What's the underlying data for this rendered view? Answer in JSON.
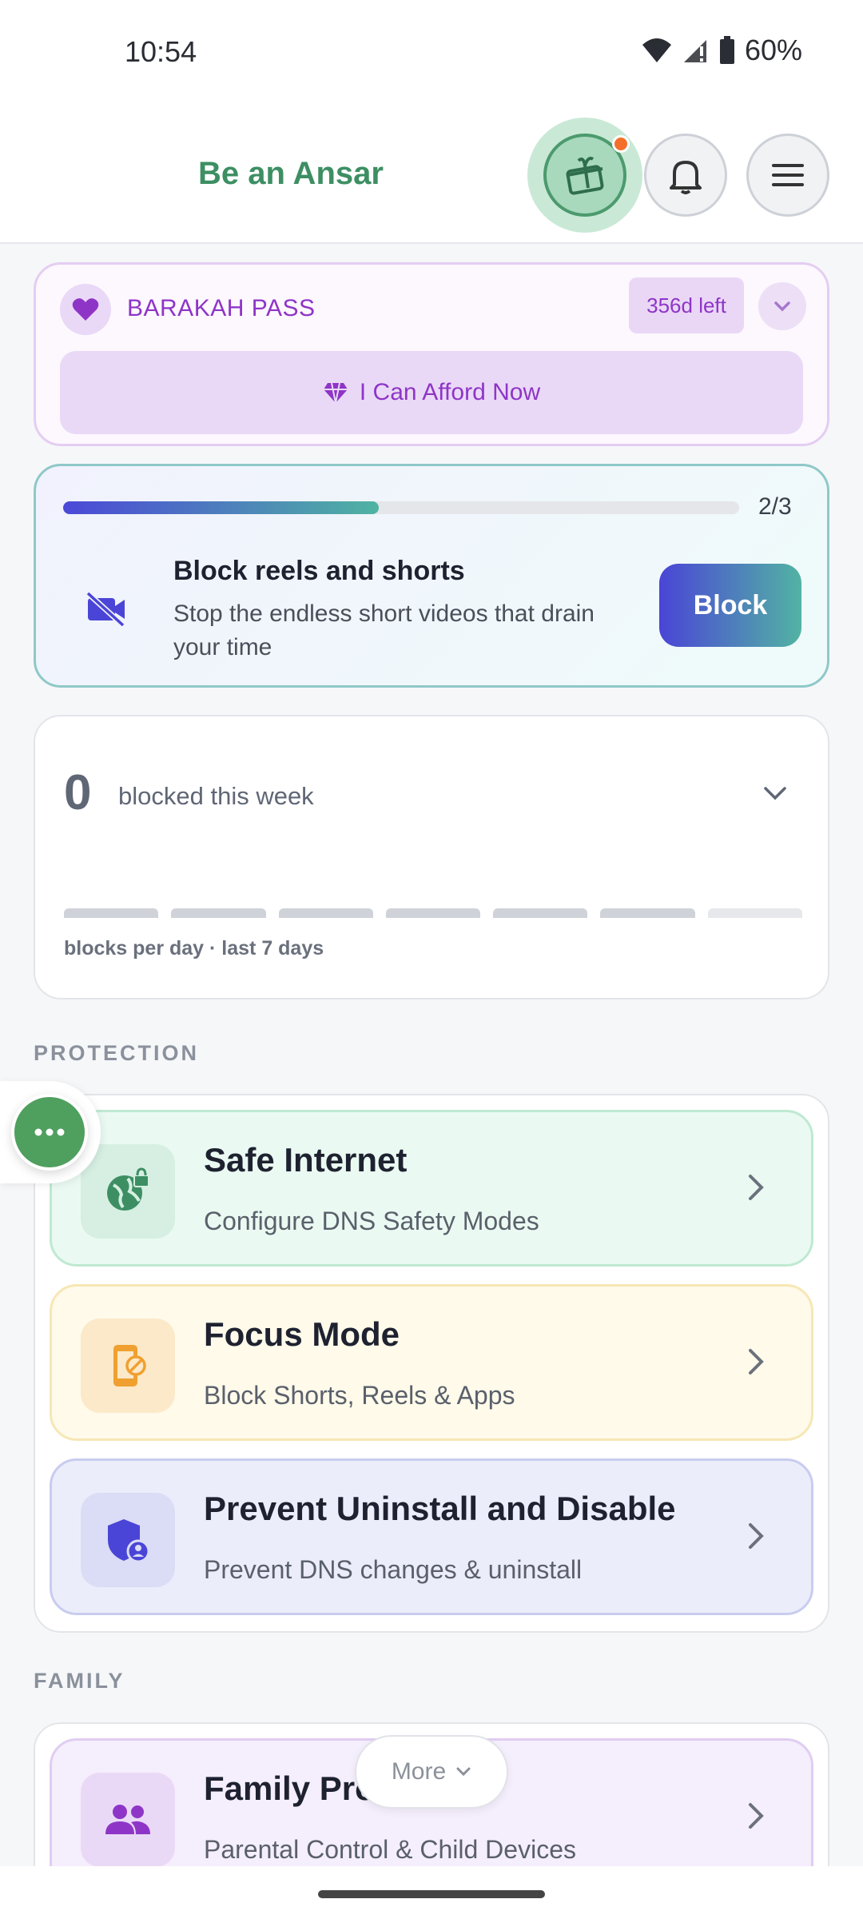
{
  "status_bar": {
    "time": "10:54",
    "battery": "60%"
  },
  "header": {
    "brand": "Be an Ansar"
  },
  "barakah": {
    "title": "BARAKAH PASS",
    "days_left": "356d left",
    "cta": "I Can Afford Now"
  },
  "task": {
    "progress_text": "2/3",
    "progress_fraction": 0.4667,
    "title": "Block reels and shorts",
    "description": "Stop the endless short videos that drain your time",
    "button": "Block"
  },
  "weekly": {
    "count": "0",
    "label": "blocked this week",
    "caption": "blocks per day · last 7 days"
  },
  "sections": {
    "protection": "PROTECTION",
    "family": "FAMILY"
  },
  "features": [
    {
      "title": "Safe Internet",
      "desc": "Configure DNS Safety Modes",
      "icon": "globe-lock-icon"
    },
    {
      "title": "Focus Mode",
      "desc": "Block Shorts, Reels & Apps",
      "icon": "phone-block-icon"
    },
    {
      "title": "Prevent Uninstall and Disable",
      "desc": "Prevent DNS changes & uninstall",
      "icon": "shield-user-icon"
    },
    {
      "title": "Family Pro",
      "desc": "Parental Control & Child Devices",
      "icon": "people-icon"
    }
  ],
  "more_button": "More",
  "colors": {
    "brand_green": "#3d8f63",
    "purple": "#8e35c7",
    "indigo": "#4a45d6",
    "teal": "#52b3a3"
  }
}
